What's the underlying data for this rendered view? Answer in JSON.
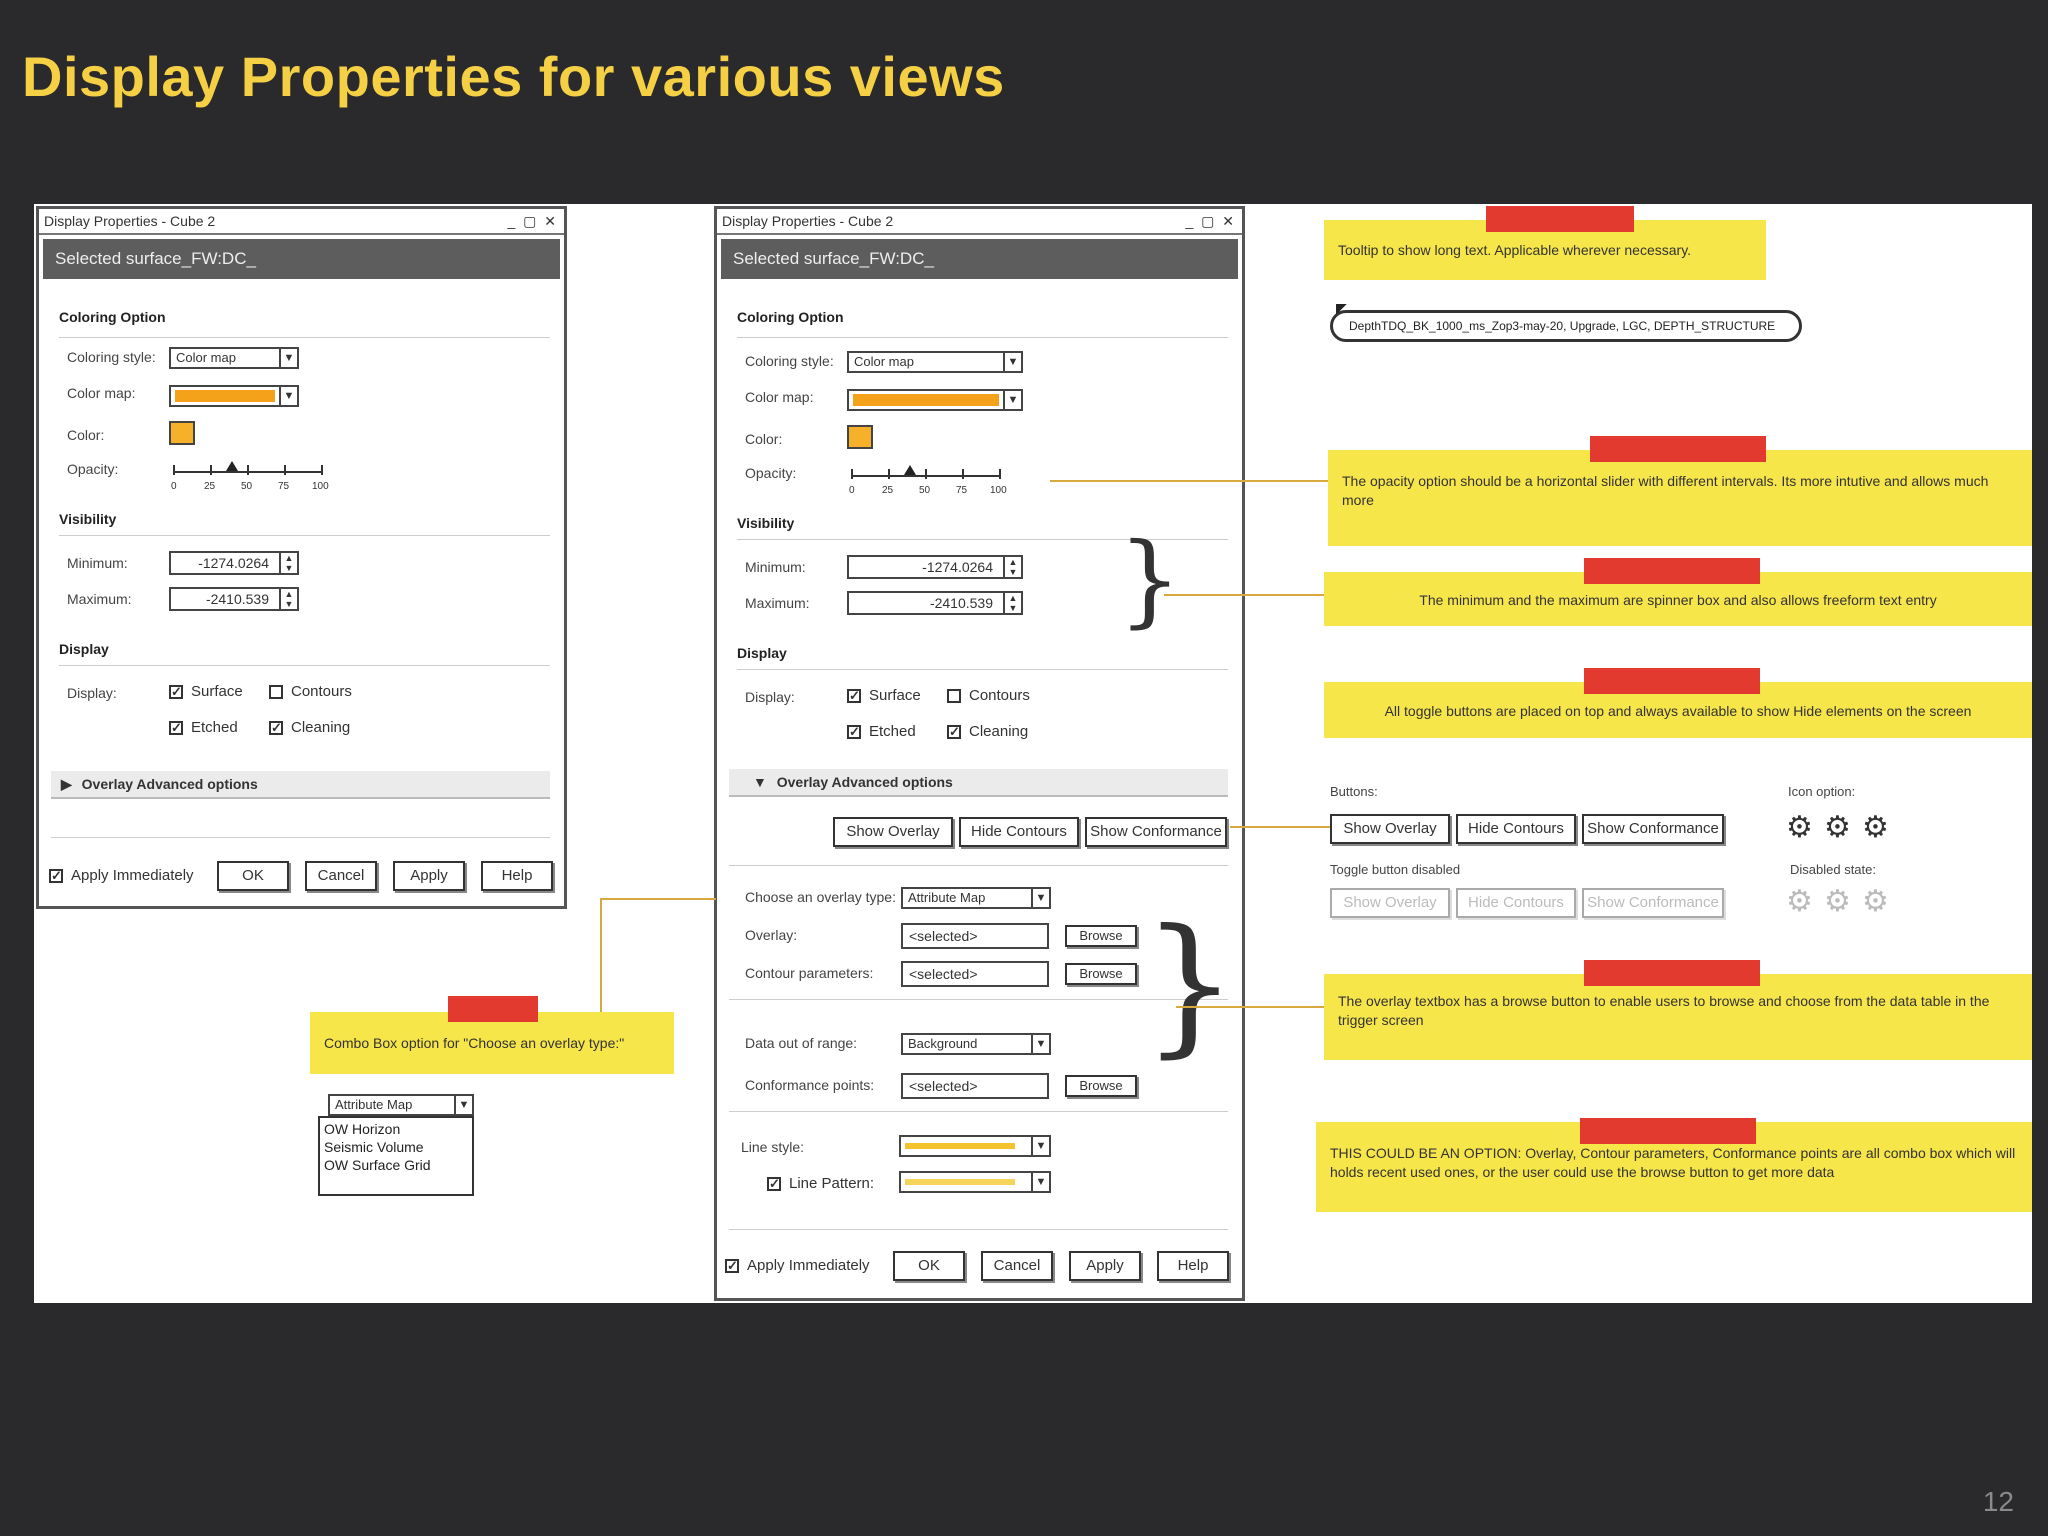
{
  "slide": {
    "title": "Display Properties for various views",
    "page_number": "12"
  },
  "dialog": {
    "title": "Display Properties - Cube 2",
    "window_controls": "_ ▢ ✕",
    "selected_surface": "Selected surface_FW:DC_",
    "coloring_section": "Coloring Option",
    "coloring_style_label": "Coloring style:",
    "coloring_style_value": "Color map",
    "color_map_label": "Color map:",
    "color_label": "Color:",
    "opacity_label": "Opacity:",
    "opacity_ticks": [
      "0",
      "25",
      "50",
      "75",
      "100"
    ],
    "opacity_value": 40,
    "visibility_section": "Visibility",
    "minimum_label": "Minimum:",
    "minimum_value": "-1274.0264",
    "maximum_label": "Maximum:",
    "maximum_value": "-2410.539",
    "display_section": "Display",
    "display_label": "Display:",
    "surface_label": "Surface",
    "contours_label": "Contours",
    "etched_label": "Etched",
    "cleaning_label": "Cleaning",
    "overlay_advanced": "Overlay Advanced options",
    "apply_immediately": "Apply Immediately",
    "ok": "OK",
    "cancel": "Cancel",
    "apply": "Apply",
    "help": "Help"
  },
  "overlay_options": {
    "show_overlay": "Show Overlay",
    "hide_contours": "Hide Contours",
    "show_conformance": "Show Conformance",
    "choose_type_label": "Choose an overlay type:",
    "choose_type_value": "Attribute Map",
    "overlay_label": "Overlay:",
    "overlay_value": "<selected>",
    "contour_params_label": "Contour parameters:",
    "contour_params_value": "<selected>",
    "data_out_label": "Data out of range:",
    "data_out_value": "Background",
    "conformance_label": "Conformance points:",
    "conformance_value": "<selected>",
    "browse": "Browse",
    "line_style_label": "Line style:",
    "line_pattern_label": "Line Pattern:"
  },
  "combo_example": {
    "note": "Combo Box option for \"Choose an overlay type:\"",
    "selected": "Attribute Map",
    "options": [
      "OW Horizon",
      "Seismic Volume",
      "OW Surface Grid"
    ]
  },
  "notes": {
    "tooltip_note": "Tooltip to show long text. Applicable wherever necessary.",
    "tooltip_text": "DepthTDQ_BK_1000_ms_Zop3-may-20, Upgrade, LGC, DEPTH_STRUCTURE",
    "opacity_note": "The opacity option should be a horizontal slider with different intervals. Its more intutive and allows much more",
    "minmax_note": "The minimum and the maximum are spinner box and also allows freeform text entry",
    "toggle_note": "All toggle buttons are placed on top and always available to show Hide elements on the screen",
    "buttons_label": "Buttons:",
    "icon_option_label": "Icon option:",
    "toggle_disabled_label": "Toggle button disabled",
    "disabled_state_label": "Disabled state:",
    "overlay_note": "The overlay textbox has a browse button to enable users to browse and choose from the data table in the trigger screen",
    "option_note": "THIS COULD BE AN OPTION: Overlay, Contour parameters, Conformance points are all combo box which will holds recent used ones, or the user could use the browse button to get more data"
  },
  "colors": {
    "title": "#f5cf44",
    "note": "#f6e649",
    "tape": "#e23a2f",
    "swatch": "#f5a21b"
  },
  "icons": {
    "gear": "gear-icon",
    "checkbox": "check-icon",
    "dropdown": "chevron-down-icon"
  }
}
